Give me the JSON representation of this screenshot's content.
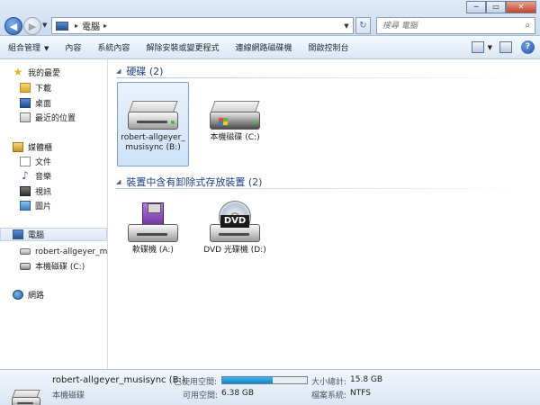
{
  "window": {
    "minimize": "─",
    "maximize": "▭",
    "close": "✕"
  },
  "nav": {
    "back_icon": "back-arrow-icon",
    "forward_icon": "forward-arrow-icon",
    "back_glyph": "◀",
    "forward_glyph": "▶",
    "recent_drop": "▼"
  },
  "address": {
    "separator_1": "▸",
    "location": "電腦",
    "separator_2": "▸",
    "drop": "▼"
  },
  "refresh": {
    "glyph": "↻"
  },
  "search": {
    "placeholder": "搜尋 電腦",
    "icon": "search-icon",
    "glyph": "⌕"
  },
  "toolbar": {
    "organize": "組合管理",
    "organize_caret": "▼",
    "properties": "內容",
    "system_properties": "系統內容",
    "uninstall": "解除安裝或變更程式",
    "map_drive": "連線網路磁碟機",
    "control_panel": "開啟控制台",
    "view_caret": "▼",
    "help": "?"
  },
  "sidebar": {
    "favorites": "我的最愛",
    "downloads": "下載",
    "desktop": "桌面",
    "recent": "最近的位置",
    "libraries": "媒體櫃",
    "documents": "文件",
    "music": "音樂",
    "videos": "視訊",
    "pictures": "圖片",
    "computer": "電腦",
    "drive_b": "robert-allgeyer_mu",
    "drive_c": "本機磁碟 (C:)",
    "network": "網路",
    "star_glyph": "★",
    "note_glyph": "♪"
  },
  "groups": {
    "hard_disks": {
      "arrow": "◢",
      "title": "硬碟 (2)"
    },
    "removable": {
      "arrow": "◢",
      "title": "裝置中含有卸除式存放裝置 (2)"
    }
  },
  "drives": {
    "drive_b": "robert-allgeyer_ musisync (B:)",
    "drive_c": "本機磁碟 (C:)",
    "drive_a": "軟碟機 (A:)",
    "drive_d": "DVD 光碟機 (D:)",
    "dvd_badge": "DVD"
  },
  "details": {
    "name": "robert-allgeyer_musisync (B:)",
    "type": "本機磁碟",
    "used_label": "已使用空間:",
    "used_fraction": 0.6,
    "free_label": "可用空間:",
    "free_value": "6.38 GB",
    "total_label": "大小總計:",
    "total_value": "15.8 GB",
    "fs_label": "檔案系統:",
    "fs_value": "NTFS"
  }
}
